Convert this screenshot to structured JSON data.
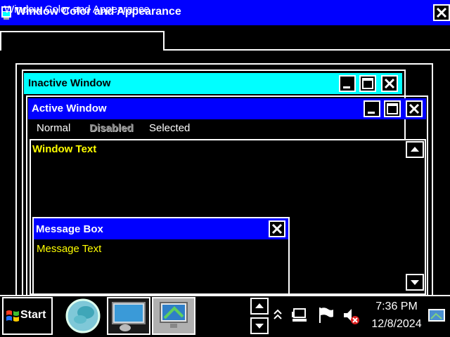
{
  "window": {
    "title": "Window Color and Appearance"
  },
  "tabs": [
    {
      "label": "Window Color and Appearance",
      "selected": true
    }
  ],
  "preview": {
    "inactive_window": {
      "title": "Inactive Window"
    },
    "active_window": {
      "title": "Active Window",
      "menu": [
        "Normal",
        "Disabled",
        "Selected"
      ],
      "window_text": "Window Text"
    },
    "message_box": {
      "title": "Message Box",
      "text": "Message Text"
    }
  },
  "taskbar": {
    "start_label": "Start",
    "clock": {
      "time": "7:36 PM",
      "date": "12/8/2024"
    },
    "buttons": [
      "help-globe-icon",
      "display-settings-icon",
      "window-color-icon"
    ],
    "tray_icons": [
      "show-hidden-icon",
      "network-icon",
      "flag-icon",
      "volume-muted-icon"
    ]
  },
  "colors": {
    "title_active": "#0000ff",
    "title_inactive": "#00ffff",
    "window_text": "#ffff00",
    "background": "#000000",
    "foreground": "#ffffff"
  }
}
